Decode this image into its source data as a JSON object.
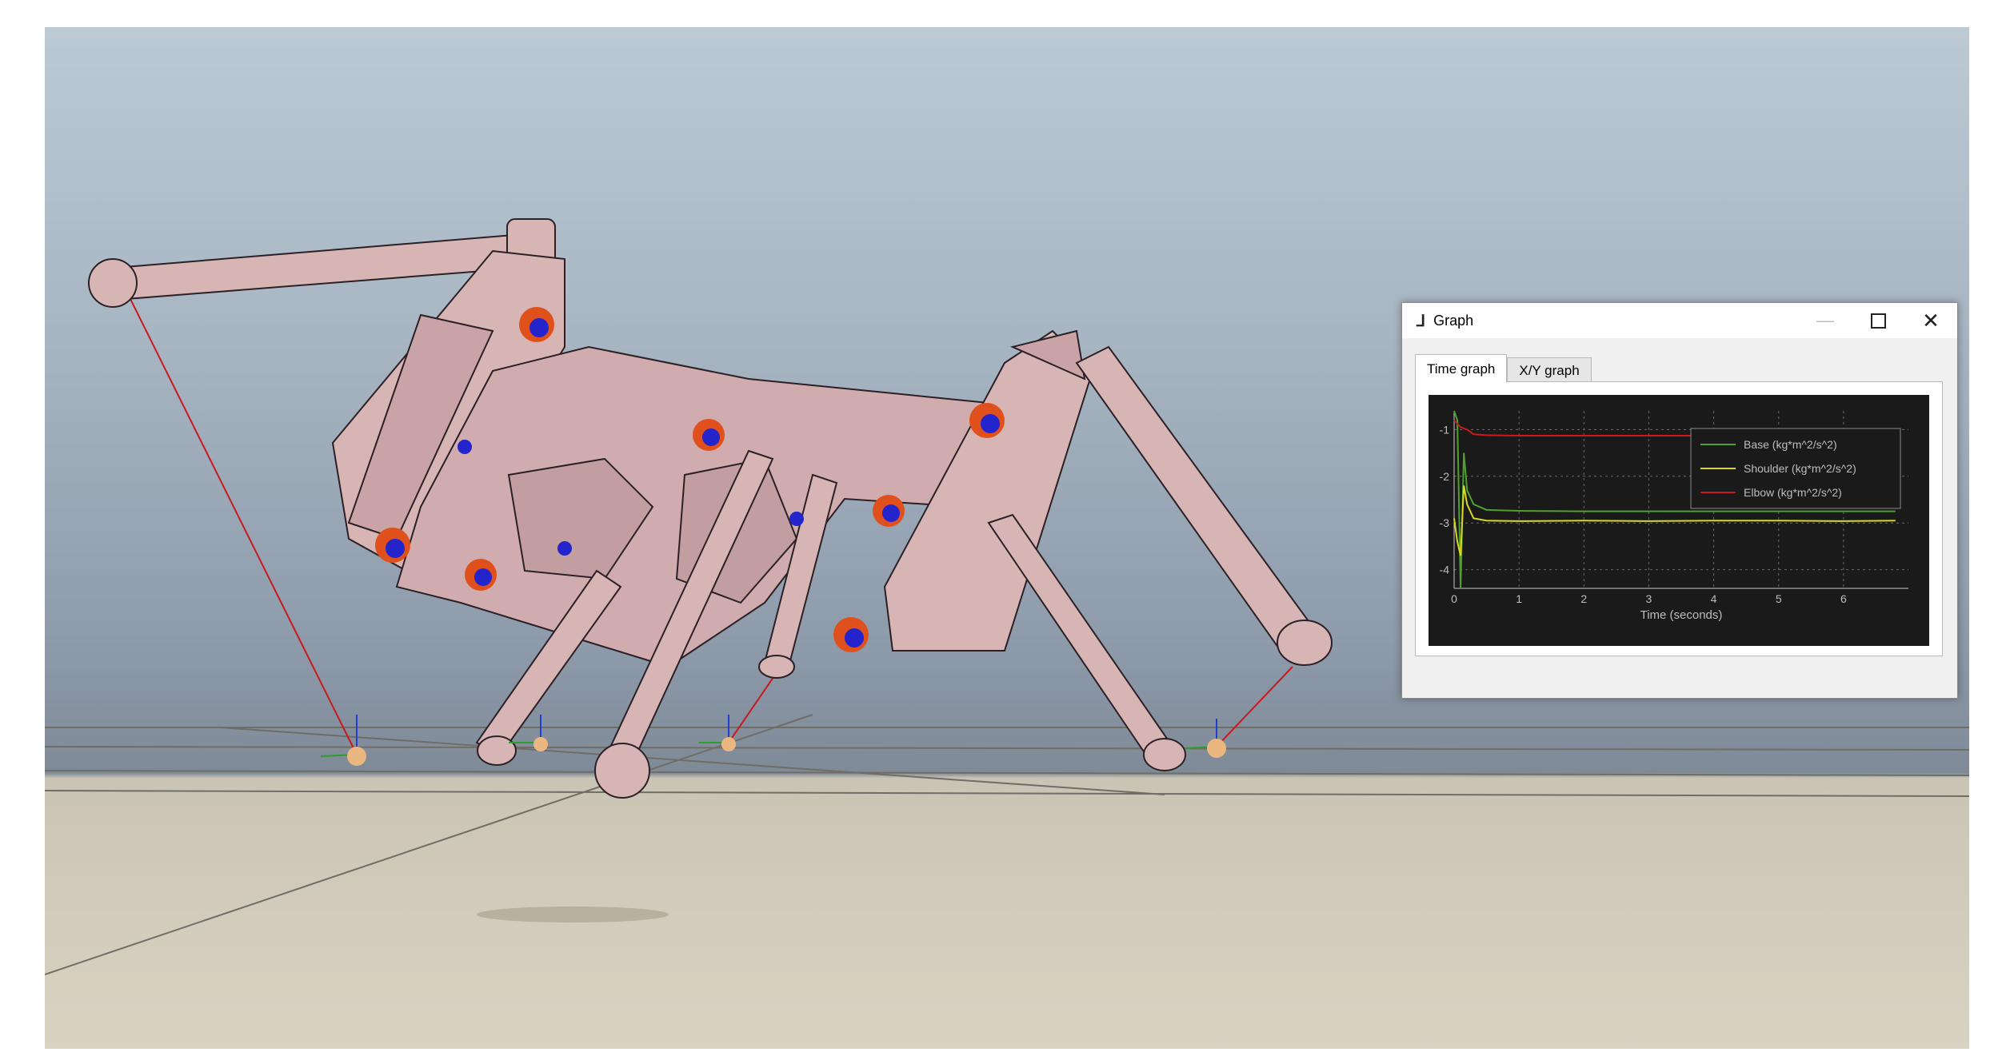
{
  "window": {
    "title": "Graph",
    "app_icon": "sim-app-icon",
    "min_glyph": "—",
    "close_glyph": "✕"
  },
  "tabs": [
    {
      "label": "Time graph",
      "active": true
    },
    {
      "label": "X/Y graph",
      "active": false
    }
  ],
  "colors": {
    "plot_bg": "#1a1a1a",
    "base": "#4fa02e",
    "shoulder": "#d8d820",
    "elbow": "#d01818"
  },
  "chart_data": {
    "type": "line",
    "xlabel": "Time (seconds)",
    "ylabel": "",
    "xlim": [
      0,
      7
    ],
    "ylim": [
      -4.4,
      -0.6
    ],
    "xticks": [
      "0",
      "1",
      "2",
      "3",
      "4",
      "5",
      "6"
    ],
    "yticks": [
      "-1",
      "-2",
      "-3",
      "-4"
    ],
    "grid": true,
    "legend": "top-right",
    "series": [
      {
        "name": "Base (kg*m^2/s^2)",
        "color": "#4fa02e",
        "x": [
          0,
          0.05,
          0.1,
          0.15,
          0.2,
          0.3,
          0.5,
          1,
          2,
          3,
          4,
          5,
          6,
          6.8
        ],
        "y": [
          -0.6,
          -0.8,
          -4.4,
          -1.5,
          -2.3,
          -2.6,
          -2.72,
          -2.74,
          -2.75,
          -2.75,
          -2.75,
          -2.75,
          -2.75,
          -2.75
        ]
      },
      {
        "name": "Shoulder (kg*m^2/s^2)",
        "color": "#d8d820",
        "x": [
          0,
          0.05,
          0.1,
          0.15,
          0.2,
          0.3,
          0.5,
          1,
          2,
          3,
          4,
          5,
          6,
          6.8
        ],
        "y": [
          -2.9,
          -3.4,
          -3.7,
          -2.2,
          -2.6,
          -2.9,
          -2.95,
          -2.96,
          -2.95,
          -2.96,
          -2.95,
          -2.95,
          -2.96,
          -2.95
        ]
      },
      {
        "name": "Elbow (kg*m^2/s^2)",
        "color": "#d01818",
        "x": [
          0,
          0.1,
          0.2,
          0.3,
          0.5,
          1,
          2,
          3,
          4,
          5,
          6,
          6.8
        ],
        "y": [
          -0.8,
          -0.95,
          -1.0,
          -1.1,
          -1.12,
          -1.13,
          -1.13,
          -1.13,
          -1.13,
          -1.13,
          -1.13,
          -1.13
        ]
      }
    ]
  }
}
